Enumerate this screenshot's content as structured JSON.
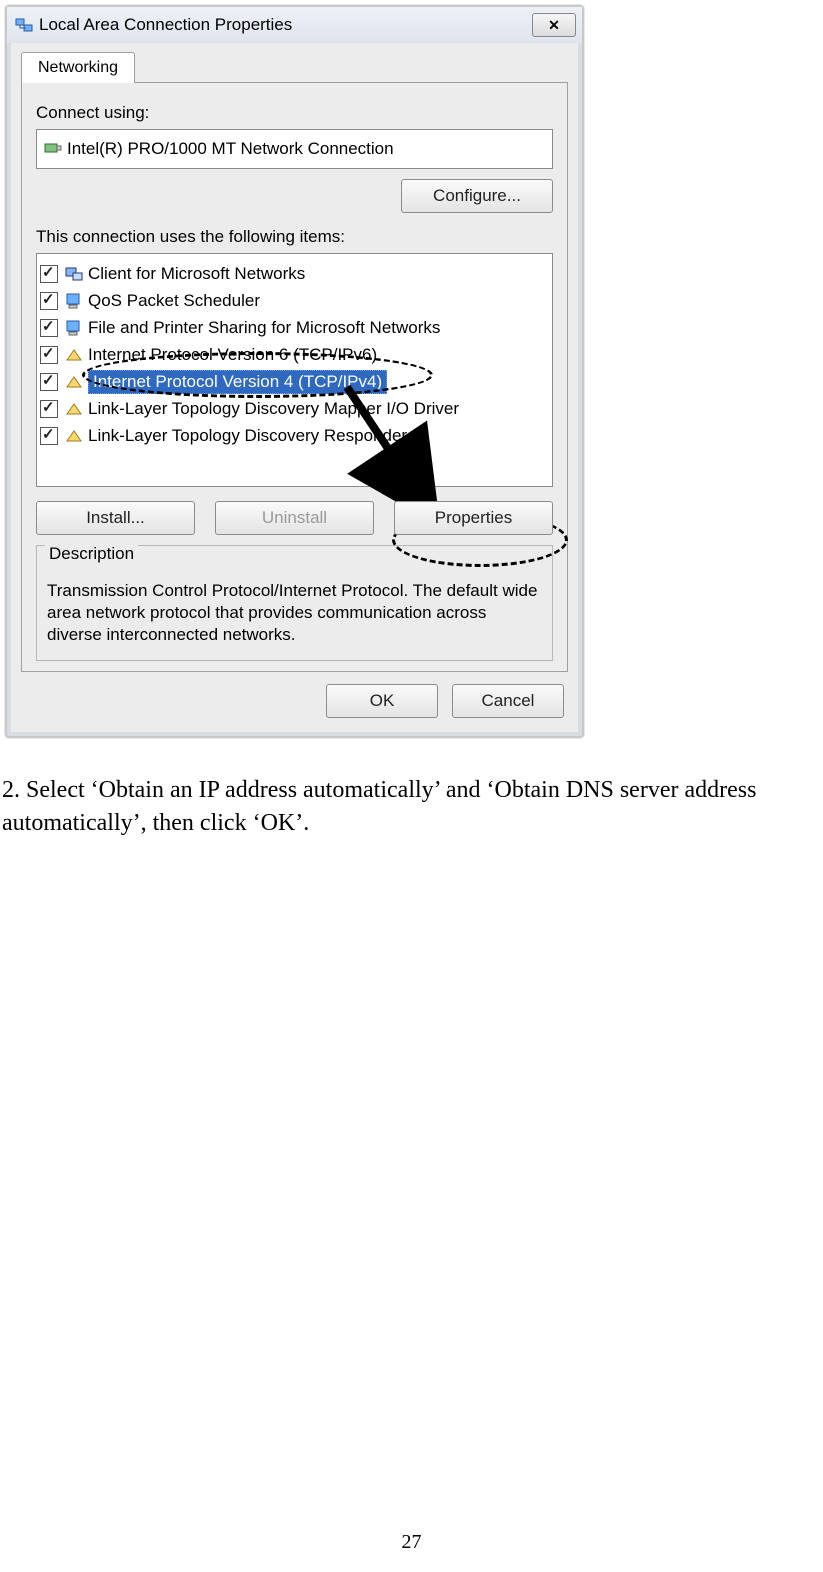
{
  "dialog": {
    "title": "Local Area Connection Properties",
    "tab": "Networking",
    "connect_label": "Connect using:",
    "adapter": "Intel(R) PRO/1000 MT Network Connection",
    "configure_btn": "Configure...",
    "items_label": "This connection uses the following items:",
    "items": [
      "Client for Microsoft Networks",
      "QoS Packet Scheduler",
      "File and Printer Sharing for Microsoft Networks",
      "Internet Protocol Version 6 (TCP/IPv6)",
      "Internet Protocol Version 4 (TCP/IPv4)",
      "Link-Layer Topology Discovery Mapper I/O Driver",
      "Link-Layer Topology Discovery Responder"
    ],
    "install_btn": "Install...",
    "uninstall_btn": "Uninstall",
    "properties_btn": "Properties",
    "desc_legend": "Description",
    "desc_text": "Transmission Control Protocol/Internet Protocol. The default wide area network protocol that provides communication across diverse interconnected networks.",
    "ok_btn": "OK",
    "cancel_btn": "Cancel"
  },
  "instruction": "2. Select ‘Obtain an IP address automatically’ and ‘Obtain DNS server address automatically’, then click ‘OK’.",
  "page_number": "27"
}
